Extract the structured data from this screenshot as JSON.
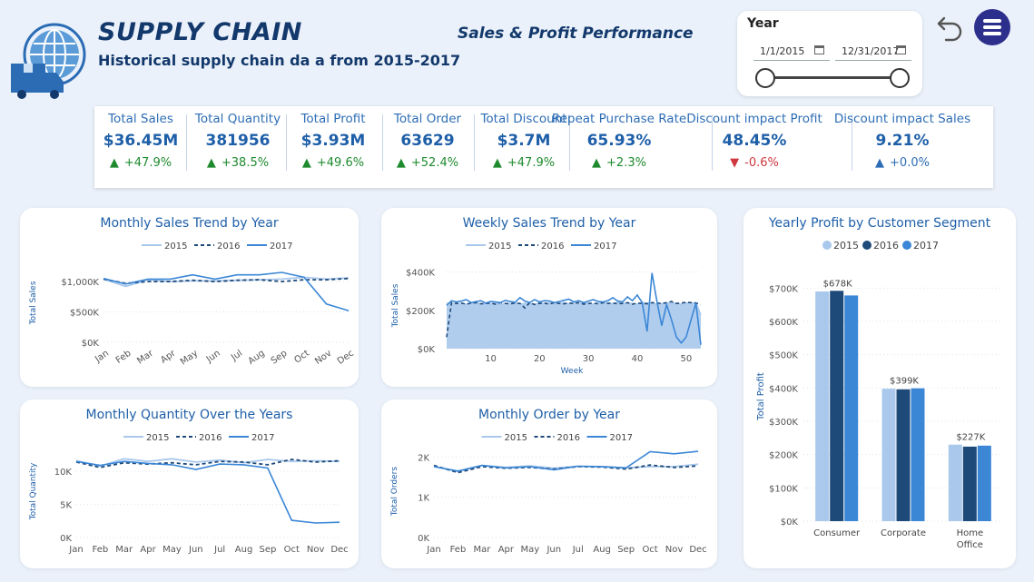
{
  "header": {
    "title": "SUPPLY CHAIN",
    "subtitle": "Historical supply chain da a from 2015-2017",
    "center_title": "Sales & Profit Performance"
  },
  "slicer": {
    "title": "Year",
    "start_date": "1/1/2015",
    "end_date": "12/31/2017"
  },
  "colors": {
    "c2015": "#a9c8ec",
    "c2016": "#1e4a7a",
    "c2017": "#3b87d6"
  },
  "kpis": [
    {
      "label": "Total Sales",
      "value": "$36.45M",
      "delta": "+47.9%",
      "dir": "up",
      "color": "green"
    },
    {
      "label": "Total Quantity",
      "value": "381956",
      "delta": "+38.5%",
      "dir": "up",
      "color": "green"
    },
    {
      "label": "Total Profit",
      "value": "$3.93M",
      "delta": "+49.6%",
      "dir": "up",
      "color": "green"
    },
    {
      "label": "Total Order",
      "value": "63629",
      "delta": "+52.4%",
      "dir": "up",
      "color": "green"
    },
    {
      "label": "Total Discount",
      "value": "$3.7M",
      "delta": "+47.9%",
      "dir": "up",
      "color": "green"
    },
    {
      "label": "Repeat Purchase Rate",
      "value": "65.93%",
      "delta": "+2.3%",
      "dir": "up",
      "color": "green"
    },
    {
      "label": "Discount impact Profit",
      "value": "48.45%",
      "delta": "-0.6%",
      "dir": "down",
      "color": "red"
    },
    {
      "label": "Discount impact Sales",
      "value": "9.21%",
      "delta": "+0.0%",
      "dir": "up",
      "color": "blue"
    }
  ],
  "chart_data": [
    {
      "id": "monthly_sales",
      "type": "line",
      "title": "Monthly Sales Trend by Year",
      "ylabel": "Total Sales",
      "categories": [
        "Jan",
        "Feb",
        "Mar",
        "Apr",
        "May",
        "Jun",
        "Jul",
        "Aug",
        "Sep",
        "Oct",
        "Nov",
        "Dec"
      ],
      "ylim": [
        0,
        1300000
      ],
      "yticks": [
        0,
        500000,
        1000000
      ],
      "ytick_labels": [
        "$0K",
        "$500K",
        "$1,000K"
      ],
      "series": [
        {
          "name": "2015",
          "values": [
            1040000,
            920000,
            1030000,
            1000000,
            1010000,
            1010000,
            1020000,
            1030000,
            1040000,
            1070000,
            1040000,
            1060000
          ]
        },
        {
          "name": "2016",
          "values": [
            1040000,
            970000,
            1000000,
            1000000,
            1020000,
            1000000,
            1020000,
            1030000,
            1000000,
            1030000,
            1030000,
            1050000
          ]
        },
        {
          "name": "2017",
          "values": [
            1050000,
            960000,
            1040000,
            1040000,
            1110000,
            1040000,
            1110000,
            1110000,
            1150000,
            1070000,
            630000,
            520000
          ]
        }
      ]
    },
    {
      "id": "weekly_sales",
      "type": "area",
      "title": "Weekly Sales Trend by Year",
      "ylabel": "Total Sales",
      "xlabel": "Week",
      "xlim": [
        1,
        53
      ],
      "xticks": [
        10,
        20,
        30,
        40,
        50
      ],
      "ylim": [
        0,
        450000
      ],
      "yticks": [
        0,
        200000,
        400000
      ],
      "ytick_labels": [
        "$0K",
        "$200K",
        "$400K"
      ],
      "x": [
        1,
        2,
        3,
        4,
        5,
        6,
        7,
        8,
        9,
        10,
        11,
        12,
        13,
        14,
        15,
        16,
        17,
        18,
        19,
        20,
        21,
        22,
        23,
        24,
        25,
        26,
        27,
        28,
        29,
        30,
        31,
        32,
        33,
        34,
        35,
        36,
        37,
        38,
        39,
        40,
        41,
        42,
        43,
        44,
        45,
        46,
        47,
        48,
        49,
        50,
        51,
        52,
        53
      ],
      "series": [
        {
          "name": "2015",
          "values": [
            235000,
            240000,
            228000,
            237000,
            232000,
            235000,
            242000,
            230000,
            236000,
            233000,
            240000,
            228000,
            236000,
            234000,
            238000,
            232000,
            236000,
            235000,
            230000,
            240000,
            234000,
            238000,
            232000,
            236000,
            240000,
            234000,
            237000,
            232000,
            240000,
            235000,
            232000,
            237000,
            236000,
            238000,
            234000,
            242000,
            236000,
            238000,
            235000,
            232000,
            240000,
            238000,
            236000,
            232000,
            235000,
            238000,
            240000,
            236000,
            232000,
            238000,
            236000,
            240000,
            176000
          ]
        },
        {
          "name": "2016",
          "values": [
            60000,
            240000,
            236000,
            238000,
            232000,
            238000,
            240000,
            234000,
            236000,
            238000,
            232000,
            240000,
            236000,
            234000,
            238000,
            236000,
            212000,
            240000,
            230000,
            236000,
            238000,
            232000,
            240000,
            236000,
            234000,
            238000,
            236000,
            240000,
            232000,
            236000,
            238000,
            234000,
            240000,
            236000,
            238000,
            234000,
            236000,
            240000,
            232000,
            238000,
            236000,
            234000,
            240000,
            238000,
            236000,
            240000,
            246000,
            236000,
            238000,
            242000,
            240000,
            238000,
            230000
          ]
        },
        {
          "name": "2017",
          "values": [
            226000,
            250000,
            244000,
            248000,
            256000,
            240000,
            246000,
            250000,
            238000,
            246000,
            244000,
            240000,
            252000,
            246000,
            242000,
            266000,
            248000,
            240000,
            256000,
            244000,
            250000,
            248000,
            240000,
            246000,
            252000,
            258000,
            244000,
            250000,
            240000,
            248000,
            256000,
            246000,
            244000,
            250000,
            266000,
            248000,
            244000,
            270000,
            250000,
            280000,
            240000,
            90000,
            395000,
            250000,
            120000,
            230000,
            150000,
            60000,
            30000,
            60000,
            150000,
            238000,
            20000
          ]
        }
      ]
    },
    {
      "id": "monthly_quantity",
      "type": "line",
      "title": "Monthly Quantity Over the Years",
      "ylabel": "Total Quantity",
      "categories": [
        "Jan",
        "Feb",
        "Mar",
        "Apr",
        "May",
        "Jun",
        "Jul",
        "Aug",
        "Sep",
        "Oct",
        "Nov",
        "Dec"
      ],
      "ylim": [
        0,
        14000
      ],
      "yticks": [
        0,
        5000,
        10000
      ],
      "ytick_labels": [
        "0K",
        "5K",
        "10K"
      ],
      "series": [
        {
          "name": "2015",
          "values": [
            11600,
            10800,
            11900,
            11500,
            11900,
            11400,
            11700,
            11300,
            11800,
            11500,
            11600,
            11500
          ]
        },
        {
          "name": "2016",
          "values": [
            11400,
            10600,
            11300,
            11100,
            11300,
            11000,
            11500,
            11400,
            11000,
            11800,
            11400,
            11600
          ]
        },
        {
          "name": "2017",
          "values": [
            11500,
            10900,
            11500,
            11200,
            11000,
            10300,
            11100,
            11000,
            10500,
            2600,
            2200,
            2300
          ]
        }
      ]
    },
    {
      "id": "monthly_order",
      "type": "line",
      "title": "Monthly Order by Year",
      "ylabel": "Total Orders",
      "categories": [
        "Jan",
        "Feb",
        "Mar",
        "Apr",
        "May",
        "Jun",
        "Jul",
        "Aug",
        "Sep",
        "Oct",
        "Nov",
        "Dec"
      ],
      "ylim": [
        0,
        2300
      ],
      "yticks": [
        0,
        1000,
        2000
      ],
      "ytick_labels": [
        "0K",
        "1K",
        "2K"
      ],
      "series": [
        {
          "name": "2015",
          "values": [
            1760,
            1640,
            1790,
            1740,
            1780,
            1720,
            1770,
            1760,
            1730,
            1760,
            1760,
            1820
          ]
        },
        {
          "name": "2016",
          "values": [
            1790,
            1610,
            1760,
            1720,
            1740,
            1700,
            1760,
            1750,
            1700,
            1800,
            1740,
            1780
          ]
        },
        {
          "name": "2017",
          "values": [
            1760,
            1650,
            1790,
            1730,
            1760,
            1680,
            1770,
            1760,
            1730,
            2130,
            2080,
            2140
          ]
        }
      ]
    },
    {
      "id": "profit_segment",
      "type": "bar",
      "title": "Yearly Profit by Customer Segment",
      "ylabel": "Total Profit",
      "categories": [
        "Consumer",
        "Corporate",
        "Home Office"
      ],
      "category_labels": [
        [
          "Consumer"
        ],
        [
          "Corporate"
        ],
        [
          "Home",
          "Office"
        ]
      ],
      "ylim": [
        0,
        750000
      ],
      "yticks": [
        0,
        100000,
        200000,
        300000,
        400000,
        500000,
        600000,
        700000
      ],
      "ytick_labels": [
        "$0K",
        "$100K",
        "$200K",
        "$300K",
        "$400K",
        "$500K",
        "$600K",
        "$700K"
      ],
      "series": [
        {
          "name": "2015",
          "values": [
            690000,
            398000,
            230000
          ]
        },
        {
          "name": "2016",
          "values": [
            692000,
            396000,
            224000
          ]
        },
        {
          "name": "2017",
          "values": [
            678000,
            399000,
            227000
          ]
        }
      ],
      "data_labels": [
        "$678K",
        "$399K",
        "$227K"
      ]
    }
  ]
}
